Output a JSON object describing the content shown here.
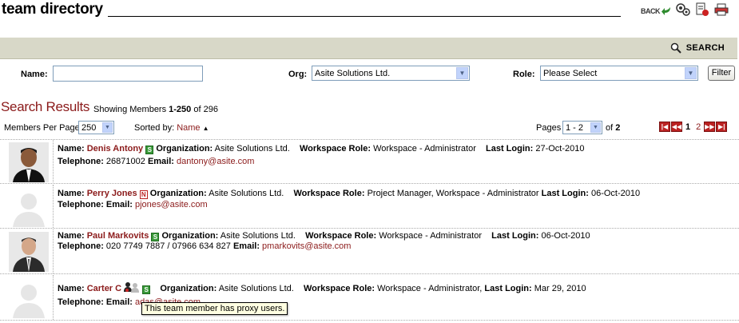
{
  "header": {
    "title": "team directory",
    "back_label": "BACK"
  },
  "search_bar": {
    "search_label": "SEARCH"
  },
  "filters": {
    "name_label": "Name:",
    "name_value": "",
    "org_label": "Org:",
    "org_value": "Asite Solutions Ltd.",
    "role_label": "Role:",
    "role_value": "Please Select",
    "filter_button": "Filter"
  },
  "results": {
    "title": "Search Results",
    "showing_prefix": "Showing Members",
    "showing_range": "1-250",
    "showing_of": "of 296"
  },
  "toolbar": {
    "members_per_page_label": "Members Per Page",
    "members_per_page_value": "250",
    "sorted_by_label": "Sorted by:",
    "sorted_by_field": "Name",
    "pages_label": "Pages",
    "pages_value": "1 - 2",
    "of_label": "of",
    "total_pages": "2",
    "page_numbers": [
      "1",
      "2"
    ],
    "current_page": "1"
  },
  "labels": {
    "name": "Name:",
    "organization": "Organization:",
    "workspace_role": "Workspace Role:",
    "last_login": "Last Login:",
    "telephone": "Telephone:",
    "email": "Email:"
  },
  "members": [
    {
      "name": "Denis Antony",
      "badge": "S",
      "organization": "Asite Solutions Ltd.",
      "workspace_role": "Workspace - Administrator",
      "last_login": "27-Oct-2010",
      "telephone": "26871002",
      "email": "dantony@asite.com"
    },
    {
      "name": "Perry Jones",
      "badge": "N",
      "organization": "Asite Solutions Ltd.",
      "workspace_role": "Project Manager, Workspace - Administrator",
      "last_login": "06-Oct-2010",
      "telephone": "",
      "email": "pjones@asite.com"
    },
    {
      "name": "Paul Markovits",
      "badge": "S",
      "organization": "Asite Solutions Ltd.",
      "workspace_role": "Workspace - Administrator",
      "last_login": "06-Oct-2010",
      "telephone": "020 7749 7887 / 07966 634 827",
      "email": "pmarkovits@asite.com"
    },
    {
      "name": "Carter C",
      "badge": "S",
      "organization": "Asite Solutions Ltd.",
      "workspace_role": "Workspace - Administrator,",
      "last_login": "Mar 29, 2010",
      "telephone": "",
      "email": "adas@asite.com"
    }
  ],
  "tooltip": "This team member has proxy users.",
  "colors": {
    "accent": "#8b1a1a",
    "search_bar_bg": "#d8d8c8",
    "badge_s": "#3a9a3a"
  }
}
